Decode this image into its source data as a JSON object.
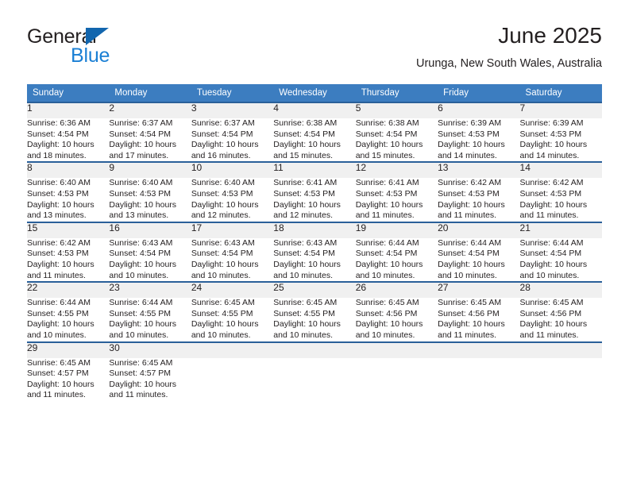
{
  "brand": {
    "name_part1": "General",
    "name_part2": "Blue",
    "triangle_icon": "brand-triangle-icon",
    "colors": {
      "general_text": "#231f20",
      "blue_text": "#1a7fd4",
      "triangle": "#1266ae"
    }
  },
  "header": {
    "title": "June 2025",
    "location": "Urunga, New South Wales, Australia"
  },
  "theme": {
    "header_bg": "#3c7dc0",
    "header_text": "#ffffff",
    "week_border": "#2a6099",
    "daynum_bg": "#f0f0f0",
    "body_text": "#231f20"
  },
  "calendar": {
    "weekday_headers": [
      "Sunday",
      "Monday",
      "Tuesday",
      "Wednesday",
      "Thursday",
      "Friday",
      "Saturday"
    ],
    "labels": {
      "sunrise_prefix": "Sunrise:",
      "sunset_prefix": "Sunset:",
      "daylight_prefix": "Daylight:"
    },
    "weeks": [
      [
        {
          "day": "1",
          "sunrise": "Sunrise: 6:36 AM",
          "sunset": "Sunset: 4:54 PM",
          "daylight_line1": "Daylight: 10 hours",
          "daylight_line2": "and 18 minutes."
        },
        {
          "day": "2",
          "sunrise": "Sunrise: 6:37 AM",
          "sunset": "Sunset: 4:54 PM",
          "daylight_line1": "Daylight: 10 hours",
          "daylight_line2": "and 17 minutes."
        },
        {
          "day": "3",
          "sunrise": "Sunrise: 6:37 AM",
          "sunset": "Sunset: 4:54 PM",
          "daylight_line1": "Daylight: 10 hours",
          "daylight_line2": "and 16 minutes."
        },
        {
          "day": "4",
          "sunrise": "Sunrise: 6:38 AM",
          "sunset": "Sunset: 4:54 PM",
          "daylight_line1": "Daylight: 10 hours",
          "daylight_line2": "and 15 minutes."
        },
        {
          "day": "5",
          "sunrise": "Sunrise: 6:38 AM",
          "sunset": "Sunset: 4:54 PM",
          "daylight_line1": "Daylight: 10 hours",
          "daylight_line2": "and 15 minutes."
        },
        {
          "day": "6",
          "sunrise": "Sunrise: 6:39 AM",
          "sunset": "Sunset: 4:53 PM",
          "daylight_line1": "Daylight: 10 hours",
          "daylight_line2": "and 14 minutes."
        },
        {
          "day": "7",
          "sunrise": "Sunrise: 6:39 AM",
          "sunset": "Sunset: 4:53 PM",
          "daylight_line1": "Daylight: 10 hours",
          "daylight_line2": "and 14 minutes."
        }
      ],
      [
        {
          "day": "8",
          "sunrise": "Sunrise: 6:40 AM",
          "sunset": "Sunset: 4:53 PM",
          "daylight_line1": "Daylight: 10 hours",
          "daylight_line2": "and 13 minutes."
        },
        {
          "day": "9",
          "sunrise": "Sunrise: 6:40 AM",
          "sunset": "Sunset: 4:53 PM",
          "daylight_line1": "Daylight: 10 hours",
          "daylight_line2": "and 13 minutes."
        },
        {
          "day": "10",
          "sunrise": "Sunrise: 6:40 AM",
          "sunset": "Sunset: 4:53 PM",
          "daylight_line1": "Daylight: 10 hours",
          "daylight_line2": "and 12 minutes."
        },
        {
          "day": "11",
          "sunrise": "Sunrise: 6:41 AM",
          "sunset": "Sunset: 4:53 PM",
          "daylight_line1": "Daylight: 10 hours",
          "daylight_line2": "and 12 minutes."
        },
        {
          "day": "12",
          "sunrise": "Sunrise: 6:41 AM",
          "sunset": "Sunset: 4:53 PM",
          "daylight_line1": "Daylight: 10 hours",
          "daylight_line2": "and 11 minutes."
        },
        {
          "day": "13",
          "sunrise": "Sunrise: 6:42 AM",
          "sunset": "Sunset: 4:53 PM",
          "daylight_line1": "Daylight: 10 hours",
          "daylight_line2": "and 11 minutes."
        },
        {
          "day": "14",
          "sunrise": "Sunrise: 6:42 AM",
          "sunset": "Sunset: 4:53 PM",
          "daylight_line1": "Daylight: 10 hours",
          "daylight_line2": "and 11 minutes."
        }
      ],
      [
        {
          "day": "15",
          "sunrise": "Sunrise: 6:42 AM",
          "sunset": "Sunset: 4:53 PM",
          "daylight_line1": "Daylight: 10 hours",
          "daylight_line2": "and 11 minutes."
        },
        {
          "day": "16",
          "sunrise": "Sunrise: 6:43 AM",
          "sunset": "Sunset: 4:54 PM",
          "daylight_line1": "Daylight: 10 hours",
          "daylight_line2": "and 10 minutes."
        },
        {
          "day": "17",
          "sunrise": "Sunrise: 6:43 AM",
          "sunset": "Sunset: 4:54 PM",
          "daylight_line1": "Daylight: 10 hours",
          "daylight_line2": "and 10 minutes."
        },
        {
          "day": "18",
          "sunrise": "Sunrise: 6:43 AM",
          "sunset": "Sunset: 4:54 PM",
          "daylight_line1": "Daylight: 10 hours",
          "daylight_line2": "and 10 minutes."
        },
        {
          "day": "19",
          "sunrise": "Sunrise: 6:44 AM",
          "sunset": "Sunset: 4:54 PM",
          "daylight_line1": "Daylight: 10 hours",
          "daylight_line2": "and 10 minutes."
        },
        {
          "day": "20",
          "sunrise": "Sunrise: 6:44 AM",
          "sunset": "Sunset: 4:54 PM",
          "daylight_line1": "Daylight: 10 hours",
          "daylight_line2": "and 10 minutes."
        },
        {
          "day": "21",
          "sunrise": "Sunrise: 6:44 AM",
          "sunset": "Sunset: 4:54 PM",
          "daylight_line1": "Daylight: 10 hours",
          "daylight_line2": "and 10 minutes."
        }
      ],
      [
        {
          "day": "22",
          "sunrise": "Sunrise: 6:44 AM",
          "sunset": "Sunset: 4:55 PM",
          "daylight_line1": "Daylight: 10 hours",
          "daylight_line2": "and 10 minutes."
        },
        {
          "day": "23",
          "sunrise": "Sunrise: 6:44 AM",
          "sunset": "Sunset: 4:55 PM",
          "daylight_line1": "Daylight: 10 hours",
          "daylight_line2": "and 10 minutes."
        },
        {
          "day": "24",
          "sunrise": "Sunrise: 6:45 AM",
          "sunset": "Sunset: 4:55 PM",
          "daylight_line1": "Daylight: 10 hours",
          "daylight_line2": "and 10 minutes."
        },
        {
          "day": "25",
          "sunrise": "Sunrise: 6:45 AM",
          "sunset": "Sunset: 4:55 PM",
          "daylight_line1": "Daylight: 10 hours",
          "daylight_line2": "and 10 minutes."
        },
        {
          "day": "26",
          "sunrise": "Sunrise: 6:45 AM",
          "sunset": "Sunset: 4:56 PM",
          "daylight_line1": "Daylight: 10 hours",
          "daylight_line2": "and 10 minutes."
        },
        {
          "day": "27",
          "sunrise": "Sunrise: 6:45 AM",
          "sunset": "Sunset: 4:56 PM",
          "daylight_line1": "Daylight: 10 hours",
          "daylight_line2": "and 11 minutes."
        },
        {
          "day": "28",
          "sunrise": "Sunrise: 6:45 AM",
          "sunset": "Sunset: 4:56 PM",
          "daylight_line1": "Daylight: 10 hours",
          "daylight_line2": "and 11 minutes."
        }
      ],
      [
        {
          "day": "29",
          "sunrise": "Sunrise: 6:45 AM",
          "sunset": "Sunset: 4:57 PM",
          "daylight_line1": "Daylight: 10 hours",
          "daylight_line2": "and 11 minutes."
        },
        {
          "day": "30",
          "sunrise": "Sunrise: 6:45 AM",
          "sunset": "Sunset: 4:57 PM",
          "daylight_line1": "Daylight: 10 hours",
          "daylight_line2": "and 11 minutes."
        },
        {
          "day": "",
          "sunrise": "",
          "sunset": "",
          "daylight_line1": "",
          "daylight_line2": ""
        },
        {
          "day": "",
          "sunrise": "",
          "sunset": "",
          "daylight_line1": "",
          "daylight_line2": ""
        },
        {
          "day": "",
          "sunrise": "",
          "sunset": "",
          "daylight_line1": "",
          "daylight_line2": ""
        },
        {
          "day": "",
          "sunrise": "",
          "sunset": "",
          "daylight_line1": "",
          "daylight_line2": ""
        },
        {
          "day": "",
          "sunrise": "",
          "sunset": "",
          "daylight_line1": "",
          "daylight_line2": ""
        }
      ]
    ]
  }
}
